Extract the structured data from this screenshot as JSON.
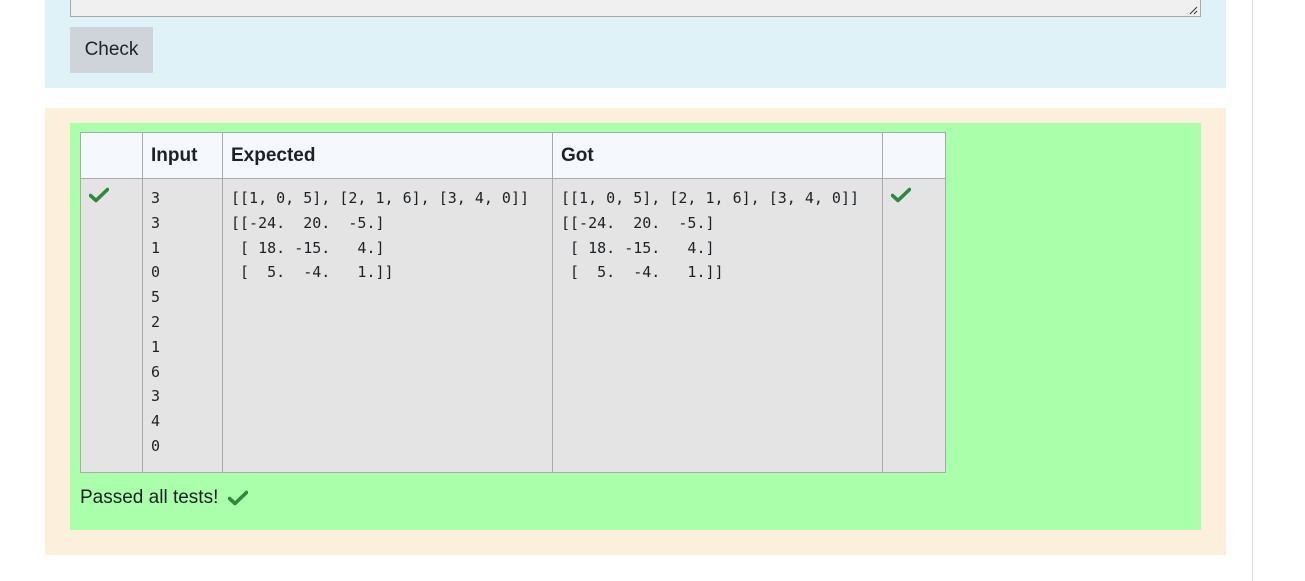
{
  "answer": {
    "check_button_label": "Check"
  },
  "results": {
    "headers": {
      "status": "",
      "input": "Input",
      "expected": "Expected",
      "got": "Got",
      "result": ""
    },
    "rows": [
      {
        "status_icon": "check-icon",
        "input": "3\n3\n1\n0\n5\n2\n1\n6\n3\n4\n0",
        "expected": "[[1, 0, 5], [2, 1, 6], [3, 4, 0]]\n[[-24.  20.  -5.]\n [ 18. -15.   4.]\n [  5.  -4.   1.]]",
        "got": "[[1, 0, 5], [2, 1, 6], [3, 4, 0]]\n[[-24.  20.  -5.]\n [ 18. -15.   4.]\n [  5.  -4.   1.]]",
        "result_icon": "check-icon"
      }
    ],
    "summary": "Passed all tests!",
    "summary_icon": "check-icon"
  },
  "colors": {
    "answer_panel_bg": "#def2f8",
    "results_outer_bg": "#fcefdc",
    "results_pass_bg": "#aaffaa",
    "check_green": "#2d8a3c",
    "button_bg": "#ced4da"
  }
}
